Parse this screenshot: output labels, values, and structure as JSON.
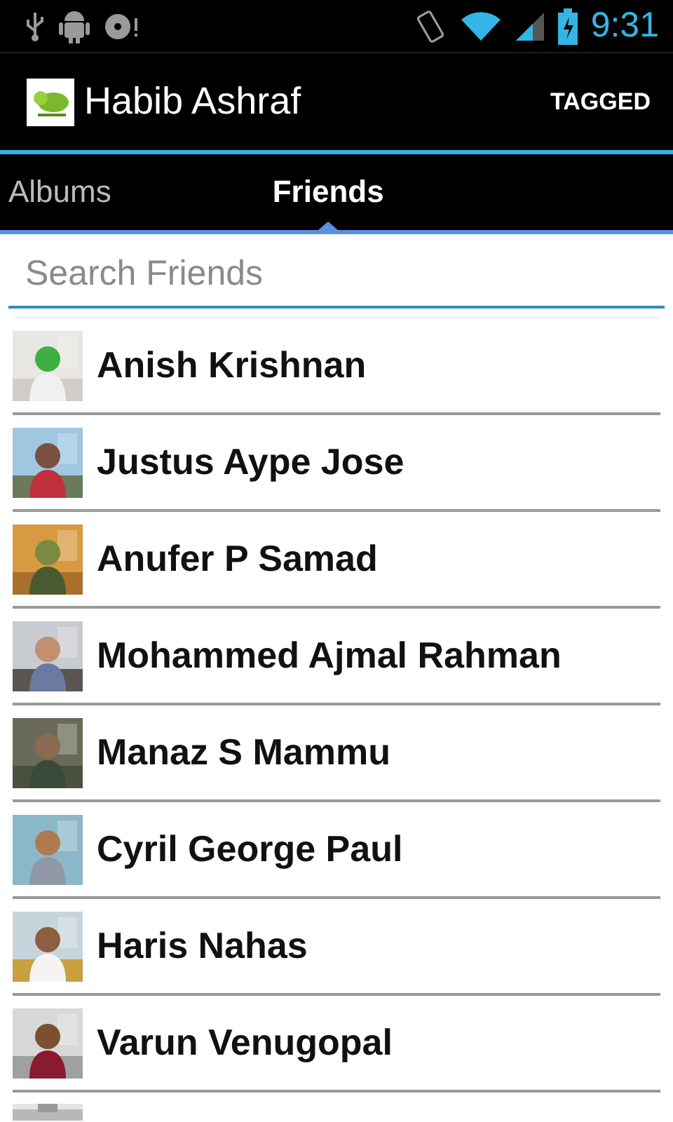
{
  "status_bar": {
    "time": "9:31"
  },
  "action_bar": {
    "title": "Habib Ashraf",
    "action": "TAGGED"
  },
  "tabs": [
    {
      "label": "Albums",
      "selected": false
    },
    {
      "label": "Friends",
      "selected": true
    }
  ],
  "search": {
    "placeholder": "Search Friends"
  },
  "friends": [
    {
      "name": "Anish Krishnan"
    },
    {
      "name": "Justus Aype Jose"
    },
    {
      "name": "Anufer P Samad"
    },
    {
      "name": "Mohammed Ajmal Rahman"
    },
    {
      "name": "Manaz S Mammu"
    },
    {
      "name": "Cyril George Paul"
    },
    {
      "name": "Haris Nahas"
    },
    {
      "name": "Varun Venugopal"
    }
  ]
}
